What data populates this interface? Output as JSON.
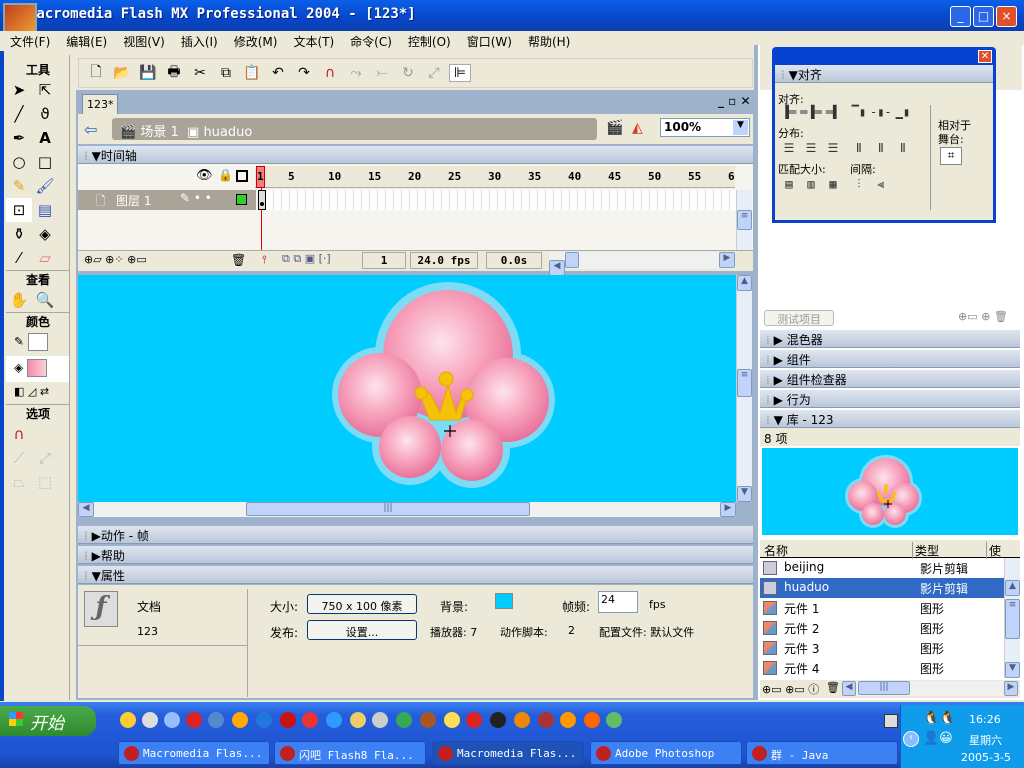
{
  "window": {
    "title": "Macromedia Flash MX Professional 2004 - [123*]",
    "buttons": [
      "_",
      "□",
      "×"
    ]
  },
  "menu": [
    "文件(F)",
    "编辑(E)",
    "视图(V)",
    "插入(I)",
    "修改(M)",
    "文本(T)",
    "命令(C)",
    "控制(O)",
    "窗口(W)",
    "帮助(H)"
  ],
  "toolbox": {
    "title": "工具",
    "view": "查看",
    "colors": "颜色",
    "options": "选项"
  },
  "document": {
    "tab": "123*",
    "scene": "场景 1",
    "symbol": "huaduo",
    "zoom": "100%"
  },
  "timeline": {
    "title": "时间轴",
    "ruler": [
      "1",
      "5",
      "10",
      "15",
      "20",
      "25",
      "30",
      "35",
      "40",
      "45",
      "50",
      "55",
      "6"
    ],
    "layer": "图层 1",
    "current_frame": "1",
    "fps": "24.0 fps",
    "time": "0.0s"
  },
  "panels": {
    "actions": "动作 - 帧",
    "help": "帮助",
    "properties": "属性"
  },
  "properties": {
    "type": "文档",
    "name": "123",
    "size_label": "大小:",
    "size_value": "750 x 100 像素",
    "bg_label": "背景:",
    "bg_color": "#00ccff",
    "fps_label": "帧频:",
    "fps_value": "24",
    "fps_unit": "fps",
    "publish_label": "发布:",
    "settings_button": "设置...",
    "player": "播放器: 7",
    "actionscript_label": "动作脚本:",
    "actionscript_value": "2",
    "profile": "配置文件: 默认文件"
  },
  "align_panel": {
    "title": "对齐",
    "align": "对齐:",
    "distribute": "分布:",
    "match_size": "匹配大小:",
    "spacing": "间隔:",
    "relative": "相对于",
    "stage": "舞台:"
  },
  "right_panels": {
    "test_project": "测试项目",
    "mixer": "混色器",
    "components": "组件",
    "component_inspector": "组件检查器",
    "behaviors": "行为",
    "library": "库 - 123",
    "item_count": "8 项"
  },
  "library": {
    "columns": [
      "名称",
      "类型",
      "使"
    ],
    "items": [
      {
        "name": "beijing",
        "type": "影片剪辑"
      },
      {
        "name": "huaduo",
        "type": "影片剪辑",
        "selected": true
      },
      {
        "name": "元件 1",
        "type": "图形"
      },
      {
        "name": "元件 2",
        "type": "图形"
      },
      {
        "name": "元件 3",
        "type": "图形"
      },
      {
        "name": "元件 4",
        "type": "图形"
      }
    ]
  },
  "taskbar": {
    "start": "开始",
    "tasks": [
      "Macromedia Flas...",
      "闪吧 Flash8 Fla...",
      "Macromedia Flas...",
      "Adobe Photoshop",
      "群 - Java"
    ],
    "time": "16:26",
    "weekday": "星期六",
    "date": "2005-3-5"
  },
  "colors": {
    "stage": "#00ccff",
    "titlebar": "#0a4fd8",
    "selection": "#316ac5"
  }
}
